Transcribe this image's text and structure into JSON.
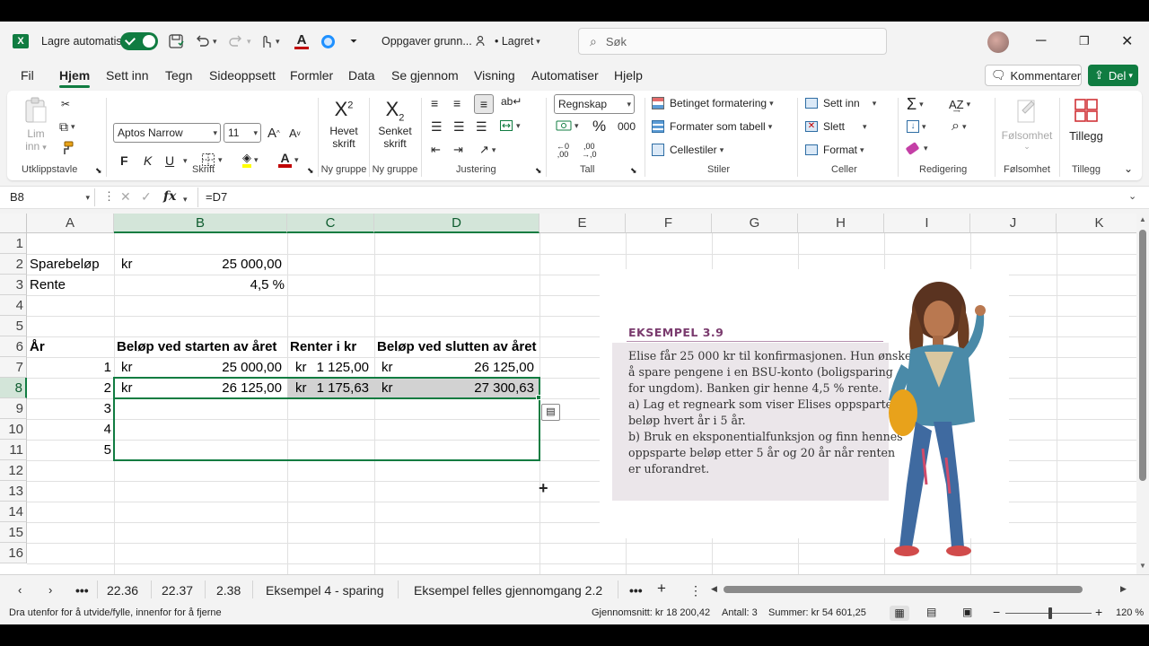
{
  "titlebar": {
    "autosave_label": "Lagre automatisk",
    "doc_title": "Oppgaver grunn...",
    "saved_status": "• Lagret",
    "search_placeholder": "Søk"
  },
  "tabs": [
    "Fil",
    "Hjem",
    "Sett inn",
    "Tegn",
    "Sideoppsett",
    "Formler",
    "Data",
    "Se gjennom",
    "Visning",
    "Automatiser",
    "Hjelp"
  ],
  "active_tab": "Hjem",
  "buttons": {
    "comment": "Kommentarer",
    "share": "Del"
  },
  "ribbon": {
    "clipboard": {
      "paste_line1": "Lim",
      "paste_line2": "inn",
      "label": "Utklippstavle"
    },
    "font": {
      "name": "Aptos Narrow",
      "size": "11",
      "bold": "F",
      "italic": "K",
      "underline": "U",
      "label": "Skrift"
    },
    "superscript": {
      "line1": "Hevet",
      "line2": "skrift",
      "label": "Ny gruppe"
    },
    "subscript": {
      "line1": "Senket",
      "line2": "skrift",
      "label": "Ny gruppe"
    },
    "alignment": {
      "label": "Justering"
    },
    "number": {
      "format": "Regnskap",
      "label": "Tall",
      "percent": "%",
      "thousands": "000"
    },
    "styles": {
      "conditional": "Betinget formatering",
      "table": "Formater som tabell",
      "cell_styles": "Cellestiler",
      "label": "Stiler"
    },
    "cells": {
      "insert": "Sett inn",
      "delete": "Slett",
      "format": "Format",
      "label": "Celler"
    },
    "editing": {
      "label": "Redigering"
    },
    "sensitivity": {
      "name": "Følsomhet",
      "label": "Følsomhet"
    },
    "addins": {
      "name": "Tillegg",
      "label": "Tillegg"
    }
  },
  "formula_bar": {
    "name_box": "B8",
    "fx": "fx",
    "formula": "=D7"
  },
  "columns": [
    "A",
    "B",
    "C",
    "D",
    "E",
    "F",
    "G",
    "H",
    "I",
    "J",
    "K"
  ],
  "rows": [
    "1",
    "2",
    "3",
    "4",
    "5",
    "6",
    "7",
    "8",
    "9",
    "10",
    "11",
    "12",
    "13",
    "14",
    "15",
    "16"
  ],
  "cells": {
    "A2": "Sparebeløp",
    "B2_cur": "kr",
    "B2": "25 000,00",
    "A3": "Rente",
    "B3": "4,5 %",
    "A6": "År",
    "B6": "Beløp ved starten av året",
    "C6": "Renter i kr",
    "D6": "Beløp ved slutten av året",
    "A7": "1",
    "B7_cur": "kr",
    "B7": "25 000,00",
    "C7_cur": "kr",
    "C7": "1 125,00",
    "D7_cur": "kr",
    "D7": "26 125,00",
    "A8": "2",
    "B8_cur": "kr",
    "B8": "26 125,00",
    "C8_cur": "kr",
    "C8": "1 175,63",
    "D8_cur": "kr",
    "D8": "27 300,63",
    "A9": "3",
    "A10": "4",
    "A11": "5"
  },
  "picture": {
    "heading": "EKSEMPEL 3.9",
    "lines": [
      "Elise får 25 000 kr til konfirmasjonen. Hun ønsker",
      "å spare pengene i en BSU-konto (boligsparing",
      "for ungdom). Banken gir henne 4,5 % rente.",
      "a)  Lag et regneark som viser Elises oppsparte",
      "      beløp hvert år i 5 år.",
      "b)  Bruk en eksponentialfunksjon og finn hennes",
      "      oppsparte beløp etter 5 år og 20 år når renten",
      "      er uforandret."
    ]
  },
  "sheet_tabs": [
    "22.36",
    "22.37",
    "2.38",
    "Eksempel 4 - sparing",
    "Eksempel felles gjennomgang 2.2"
  ],
  "status": {
    "message": "Dra utenfor for å utvide/fylle, innenfor for å fjerne",
    "average": "Gjennomsnitt:  kr 18 200,42",
    "count": "Antall: 3",
    "sum": "Summer:  kr 54 601,25",
    "zoom": "120 %"
  },
  "colors": {
    "accent": "#107c41",
    "selection": "#d3e5d9",
    "heading": "#7a3b6e"
  }
}
